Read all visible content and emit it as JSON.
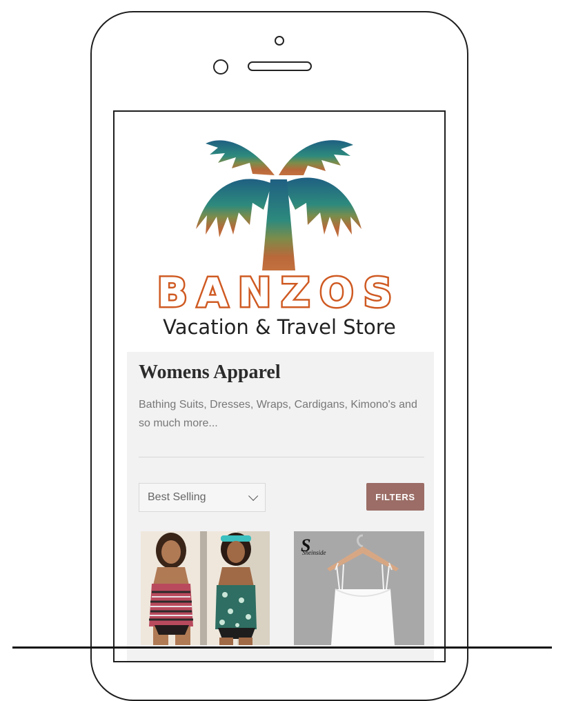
{
  "store": {
    "brand_name": "BANZOS",
    "tagline": "Vacation & Travel Store"
  },
  "collection": {
    "title": "Womens Apparel",
    "description": "Bathing Suits, Dresses, Wraps, Cardigans, Kimono's and so much more..."
  },
  "toolbar": {
    "sort_selected": "Best Selling",
    "filters_label": "FILTERS"
  },
  "products": [
    {
      "image": "two models in tankini swimsuits"
    },
    {
      "image": "white camisole on hanger",
      "brand_mark": "S",
      "brand_mark_text": "Sheinside"
    }
  ],
  "colors": {
    "brand_orange": "#cf5a22",
    "filters_button": "#9b6d66",
    "panel_bg": "#f2f2f3"
  }
}
